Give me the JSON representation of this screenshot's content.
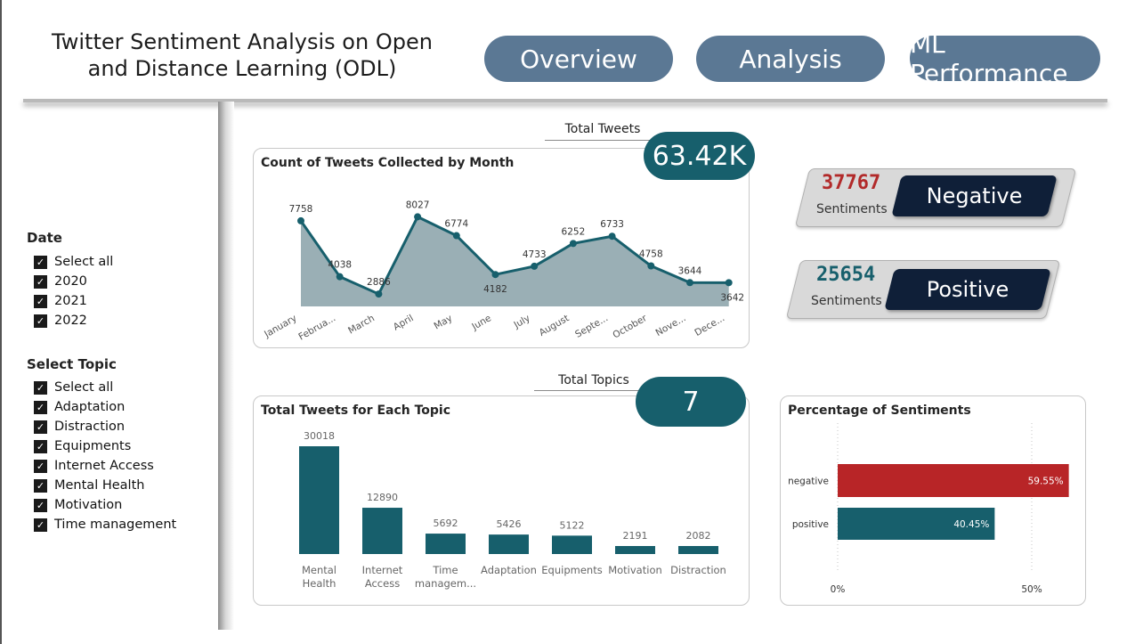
{
  "header": {
    "title_line1": "Twitter Sentiment Analysis on Open",
    "title_line2": "and Distance Learning (ODL)",
    "nav": [
      "Overview",
      "Analysis",
      "ML Performance"
    ]
  },
  "filters": {
    "date": {
      "title": "Date",
      "items": [
        "Select all",
        "2020",
        "2021",
        "2022"
      ]
    },
    "topic": {
      "title": "Select Topic",
      "items": [
        "Select all",
        "Adaptation",
        "Distraction",
        "Equipments",
        "Internet Access",
        "Mental Health",
        "Motivation",
        "Time management"
      ]
    }
  },
  "kpis": {
    "total_tweets_label": "Total Tweets",
    "total_tweets_value": "63.42K",
    "total_topics_label": "Total Topics",
    "total_topics_value": "7"
  },
  "sentiments": {
    "negative": {
      "count": "37767",
      "sub": "Sentiments",
      "label": "Negative",
      "color": "#b22a2a"
    },
    "positive": {
      "count": "25654",
      "sub": "Sentiments",
      "label": "Positive",
      "color": "#175f6c"
    }
  },
  "chart_data": [
    {
      "type": "area",
      "title": "Count of Tweets Collected by Month",
      "categories": [
        "January",
        "Februa...",
        "March",
        "April",
        "May",
        "June",
        "July",
        "August",
        "Septe...",
        "October",
        "Nove...",
        "Dece..."
      ],
      "values": [
        7758,
        4038,
        2886,
        8027,
        6774,
        4182,
        4733,
        6252,
        6733,
        4758,
        3644,
        3642
      ],
      "labels": [
        "7758",
        "4038",
        "2886",
        "8027",
        "6774",
        "4182",
        "4733",
        "6252",
        "6733",
        "4758",
        "3644",
        "3642"
      ],
      "ylim": [
        2000,
        9000
      ],
      "color": "#175f6c",
      "fill": "#9aafb5"
    },
    {
      "type": "bar",
      "title": "Total Tweets for Each Topic",
      "categories": [
        [
          "Mental",
          "Health"
        ],
        [
          "Internet",
          "Access"
        ],
        [
          "Time",
          "managem..."
        ],
        [
          "Adaptation"
        ],
        [
          "Equipments"
        ],
        [
          "Motivation"
        ],
        [
          "Distraction"
        ]
      ],
      "values": [
        30018,
        12890,
        5692,
        5426,
        5122,
        2191,
        2082
      ],
      "labels": [
        "30018",
        "12890",
        "5692",
        "5426",
        "5122",
        "2191",
        "2082"
      ],
      "ylim": [
        0,
        33000
      ],
      "color": "#175f6c"
    },
    {
      "type": "bar",
      "orientation": "horizontal",
      "title": "Percentage of Sentiments",
      "categories": [
        "negative",
        "positive"
      ],
      "values": [
        59.55,
        40.45
      ],
      "labels": [
        "59.55%",
        "40.45%"
      ],
      "colors": [
        "#b82527",
        "#175f6c"
      ],
      "xticks": [
        "0%",
        "50%"
      ],
      "xlim": [
        0,
        60
      ]
    }
  ]
}
